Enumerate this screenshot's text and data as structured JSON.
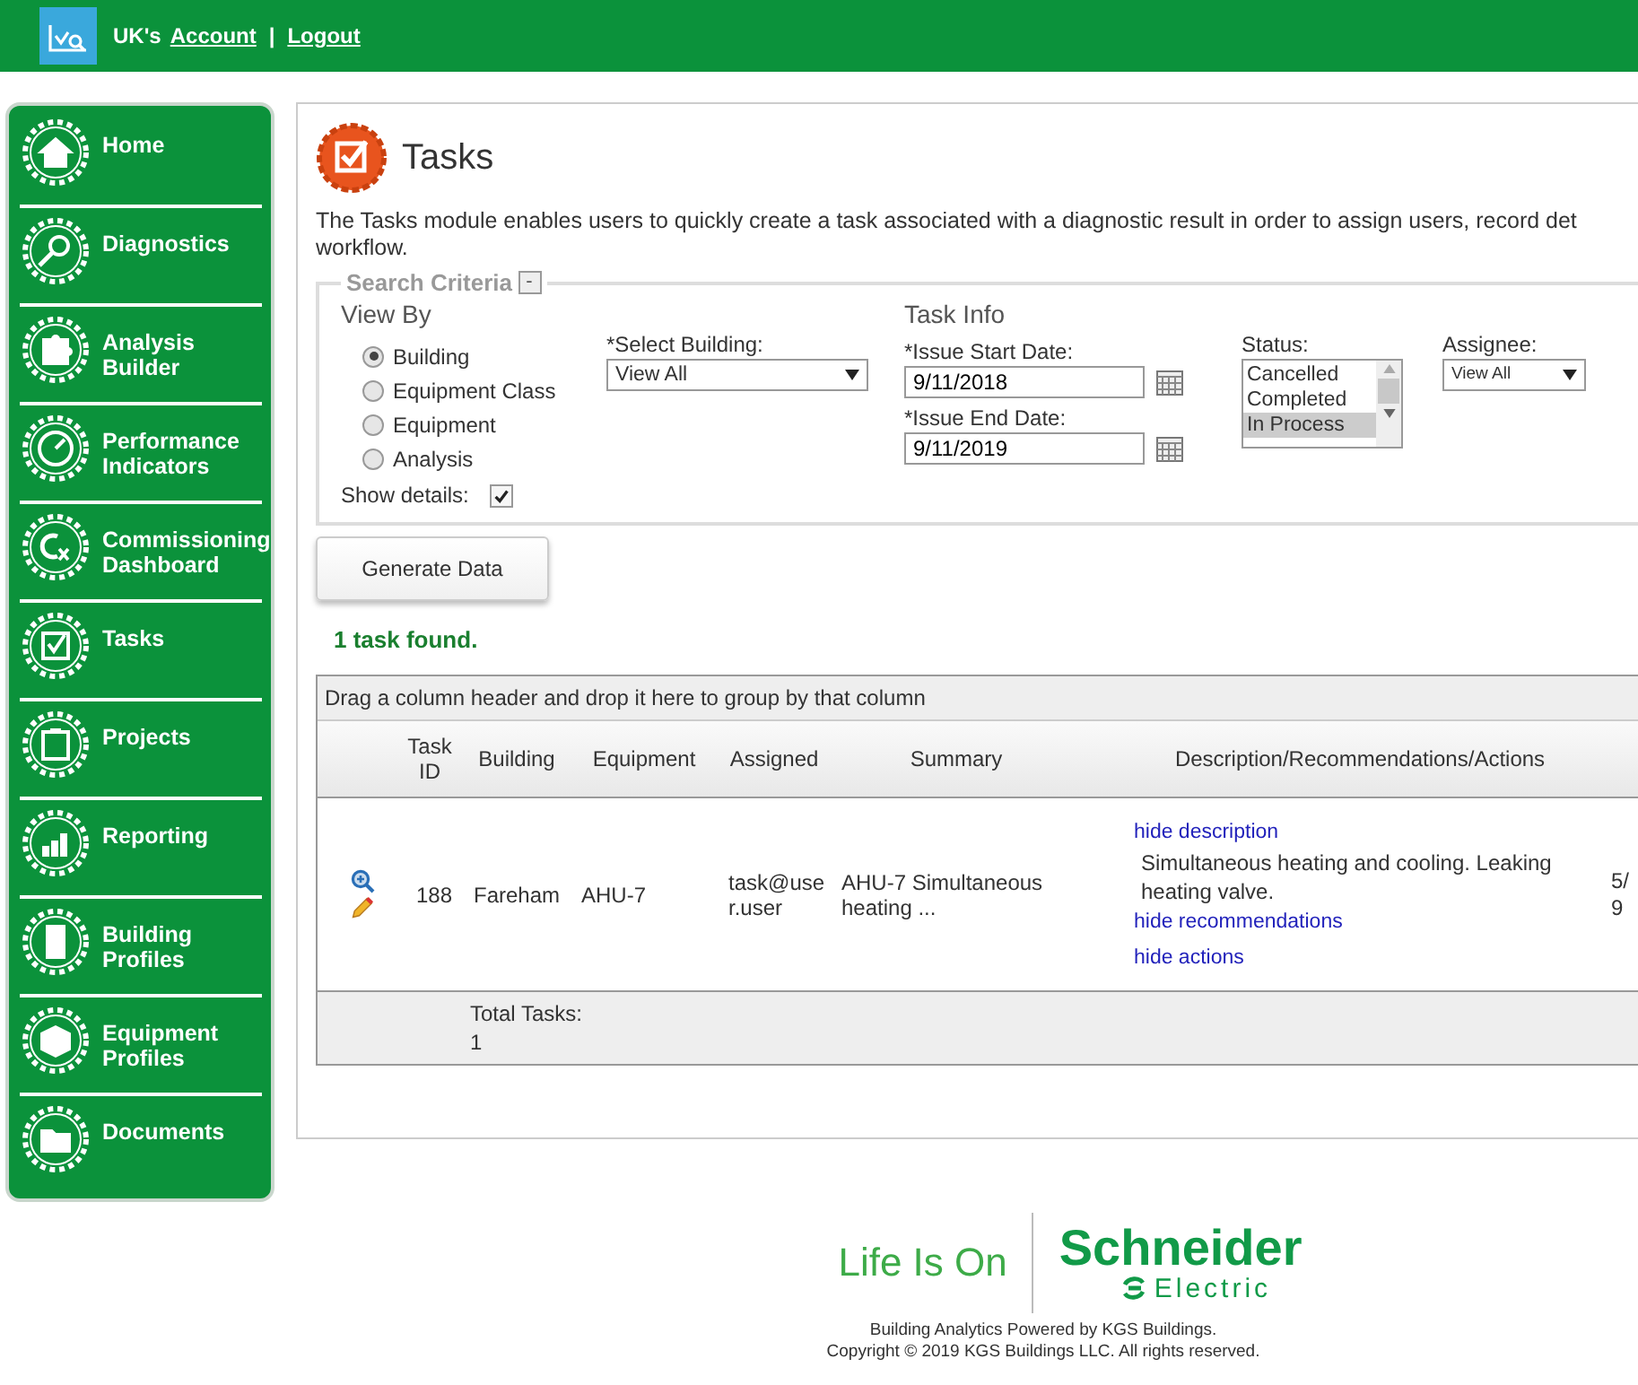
{
  "header": {
    "user": "UK's",
    "account_link": "Account",
    "separator": "|",
    "logout_link": "Logout"
  },
  "sidebar": {
    "items": [
      {
        "label": "Home"
      },
      {
        "label": "Diagnostics"
      },
      {
        "label": "Analysis Builder"
      },
      {
        "label": "Performance Indicators"
      },
      {
        "label": "Commissioning Dashboard"
      },
      {
        "label": "Tasks"
      },
      {
        "label": "Projects"
      },
      {
        "label": "Reporting"
      },
      {
        "label": "Building Profiles"
      },
      {
        "label": "Equipment Profiles"
      },
      {
        "label": "Documents"
      }
    ]
  },
  "page": {
    "title": "Tasks",
    "description_lines": [
      "The Tasks module enables users to quickly create a task associated with a diagnostic result in order to assign users, record det",
      "workflow."
    ]
  },
  "search_criteria": {
    "legend": "Search Criteria",
    "collapse_button": "-",
    "view_by": {
      "heading": "View By",
      "options": [
        {
          "label": "Building",
          "selected": true
        },
        {
          "label": "Equipment Class",
          "selected": false
        },
        {
          "label": "Equipment",
          "selected": false
        },
        {
          "label": "Analysis",
          "selected": false
        }
      ]
    },
    "select_building": {
      "label": "*Select Building:",
      "value": "View All"
    },
    "task_info": {
      "heading": "Task Info",
      "start_date": {
        "label": "*Issue Start Date:",
        "value": "9/11/2018"
      },
      "end_date": {
        "label": "*Issue End Date:",
        "value": "9/11/2019"
      }
    },
    "status": {
      "label": "Status:",
      "options": [
        {
          "label": "Cancelled",
          "selected": false
        },
        {
          "label": "Completed",
          "selected": false
        },
        {
          "label": "In Process",
          "selected": true
        }
      ]
    },
    "assignee": {
      "label": "Assignee:",
      "value": "View All"
    },
    "show_details": {
      "label": "Show details:",
      "checked": true
    }
  },
  "generate_button": "Generate Data",
  "result_message": "1 task found.",
  "table": {
    "group_hint": "Drag a column header and drop it here to group by that column",
    "columns": [
      "",
      "Task ID",
      "Building",
      "Equipment",
      "Assigned",
      "Summary",
      "Description/Recommendations/Actions",
      ""
    ],
    "rows": [
      {
        "task_id": "188",
        "building": "Fareham",
        "equipment": "AHU-7",
        "assigned": "task@user.user",
        "summary": "AHU-7 Simultaneous heating ...",
        "hide_description": "hide description",
        "description": "Simultaneous heating and cooling. Leaking heating valve.",
        "hide_recommendations": "hide recommendations",
        "hide_actions": "hide actions",
        "column_8": [
          "5/",
          "9"
        ]
      }
    ],
    "footer": {
      "total_label": "Total Tasks:",
      "total_value": "1"
    }
  },
  "footer": {
    "slogan": "Life Is On",
    "brand": "Schneider",
    "brand_sub": "Electric",
    "powered_by": "Building Analytics Powered by KGS Buildings.",
    "copyright": "Copyright © 2019 KGS Buildings LLC. All rights reserved."
  }
}
